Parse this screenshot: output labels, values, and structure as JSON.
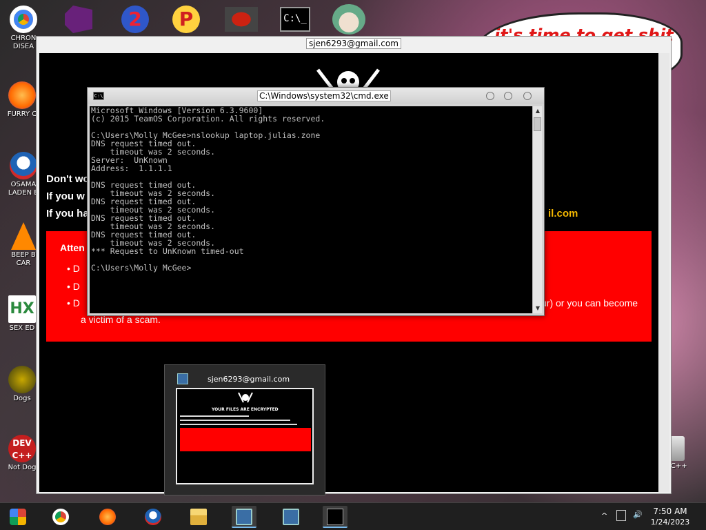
{
  "desktop": {
    "icons": [
      {
        "label": "CHRON DISEA",
        "icon": "chrome-icon"
      },
      {
        "label": "FURRY C",
        "icon": "firefox-icon"
      },
      {
        "label": "OSAMA LADEN B",
        "icon": "obama-logo-icon"
      },
      {
        "label": "BEEP B CAR",
        "icon": "vlc-cone-icon"
      },
      {
        "label": "SEX ED",
        "icon": "hx-icon"
      },
      {
        "label": "Dogs",
        "icon": "dog-icon"
      },
      {
        "label": "Not Dog",
        "icon": "devcpp-icon"
      },
      {
        "label": "n C++",
        "icon": "recycle-bin-icon"
      }
    ],
    "wallpaper_text": "it's time to get shit"
  },
  "ransom_window": {
    "title": "sjen6293@gmail.com",
    "lines": [
      "Don't wo",
      "If you w",
      "If you ha"
    ],
    "email_fragment": "il.com",
    "attention": "Atten",
    "bullets": [
      "D",
      "D",
      "D"
    ],
    "tail_text": "ur) or you can become",
    "tail_text2": "a victim of a scam."
  },
  "cmd_window": {
    "title": "C:\\Windows\\system32\\cmd.exe",
    "output": "Microsoft Windows [Version 6.3.9600]\n(c) 2015 TeamOS Corporation. All rights reserved.\n\nC:\\Users\\Molly McGee>nslookup laptop.julias.zone\nDNS request timed out.\n    timeout was 2 seconds.\nServer:  UnKnown\nAddress:  1.1.1.1\n\nDNS request timed out.\n    timeout was 2 seconds.\nDNS request timed out.\n    timeout was 2 seconds.\nDNS request timed out.\n    timeout was 2 seconds.\nDNS request timed out.\n    timeout was 2 seconds.\n*** Request to UnKnown timed-out\n\nC:\\Users\\Molly McGee>"
  },
  "preview": {
    "title": "sjen6293@gmail.com",
    "thumb_title": "YOUR FILES ARE ENCRYPTED"
  },
  "taskbar": {
    "items": [
      "start-icon",
      "chrome-icon",
      "firefox-icon",
      "obama-logo-icon",
      "file-explorer-icon",
      "ransomware-app-icon",
      "ransomware-app-icon-2",
      "cmd-icon"
    ],
    "tray_up_arrow": "^",
    "time": "7:50 AM",
    "date": "1/24/2023"
  },
  "colors": {
    "ransom_red": "#ff0000",
    "email_yellow": "#f5b800",
    "taskbar_bg": "#1f1f1f"
  }
}
